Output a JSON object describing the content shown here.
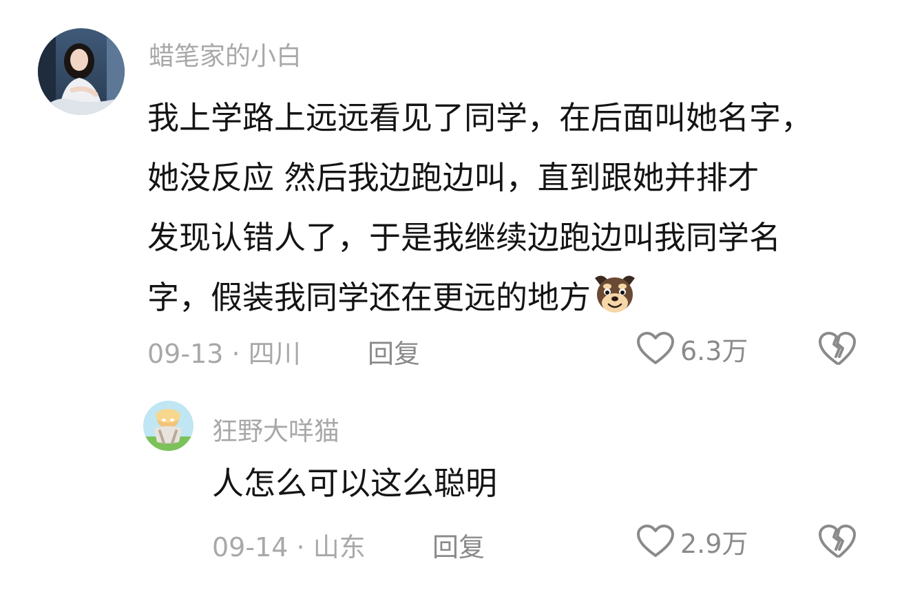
{
  "comments": [
    {
      "username": "蜡笔家的小白",
      "lines": [
        "我上学路上远远看见了同学，在后面叫她名字，",
        "她没反应  然后我边跑边叫，直到跟她并排才",
        "发现认错人了，于是我继续边跑边叫我同学名",
        "字，假装我同学还在更远的地方"
      ],
      "trailing_emoji": "dog-emoji",
      "date": "09-13",
      "separator": "·",
      "location": "四川",
      "reply_label": "回复",
      "like_count": "6.3万"
    },
    {
      "username": "狂野大咩猫",
      "lines": [
        "人怎么可以这么聪明"
      ],
      "date": "09-14",
      "separator": "·",
      "location": "山东",
      "reply_label": "回复",
      "like_count": "2.9万"
    }
  ],
  "colors": {
    "meta_gray": "#a8a8a8",
    "text": "#141414",
    "icon_gray": "#8a8a8a"
  }
}
